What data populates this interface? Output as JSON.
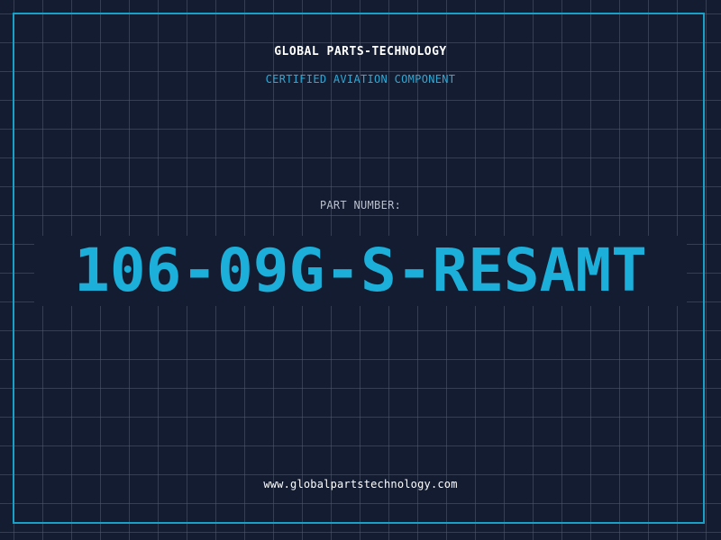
{
  "header": {
    "brand": "GLOBAL PARTS-TECHNOLOGY",
    "tagline": "CERTIFIED AVIATION COMPONENT"
  },
  "part": {
    "label": "PART NUMBER:",
    "number": "106-09G-S-RESAMT"
  },
  "footer": {
    "website": "www.globalpartstechnology.com"
  },
  "colors": {
    "background": "#131c31",
    "grid": "#1e6e8c",
    "accent": "#1cafd9",
    "text": "#ffffff"
  }
}
